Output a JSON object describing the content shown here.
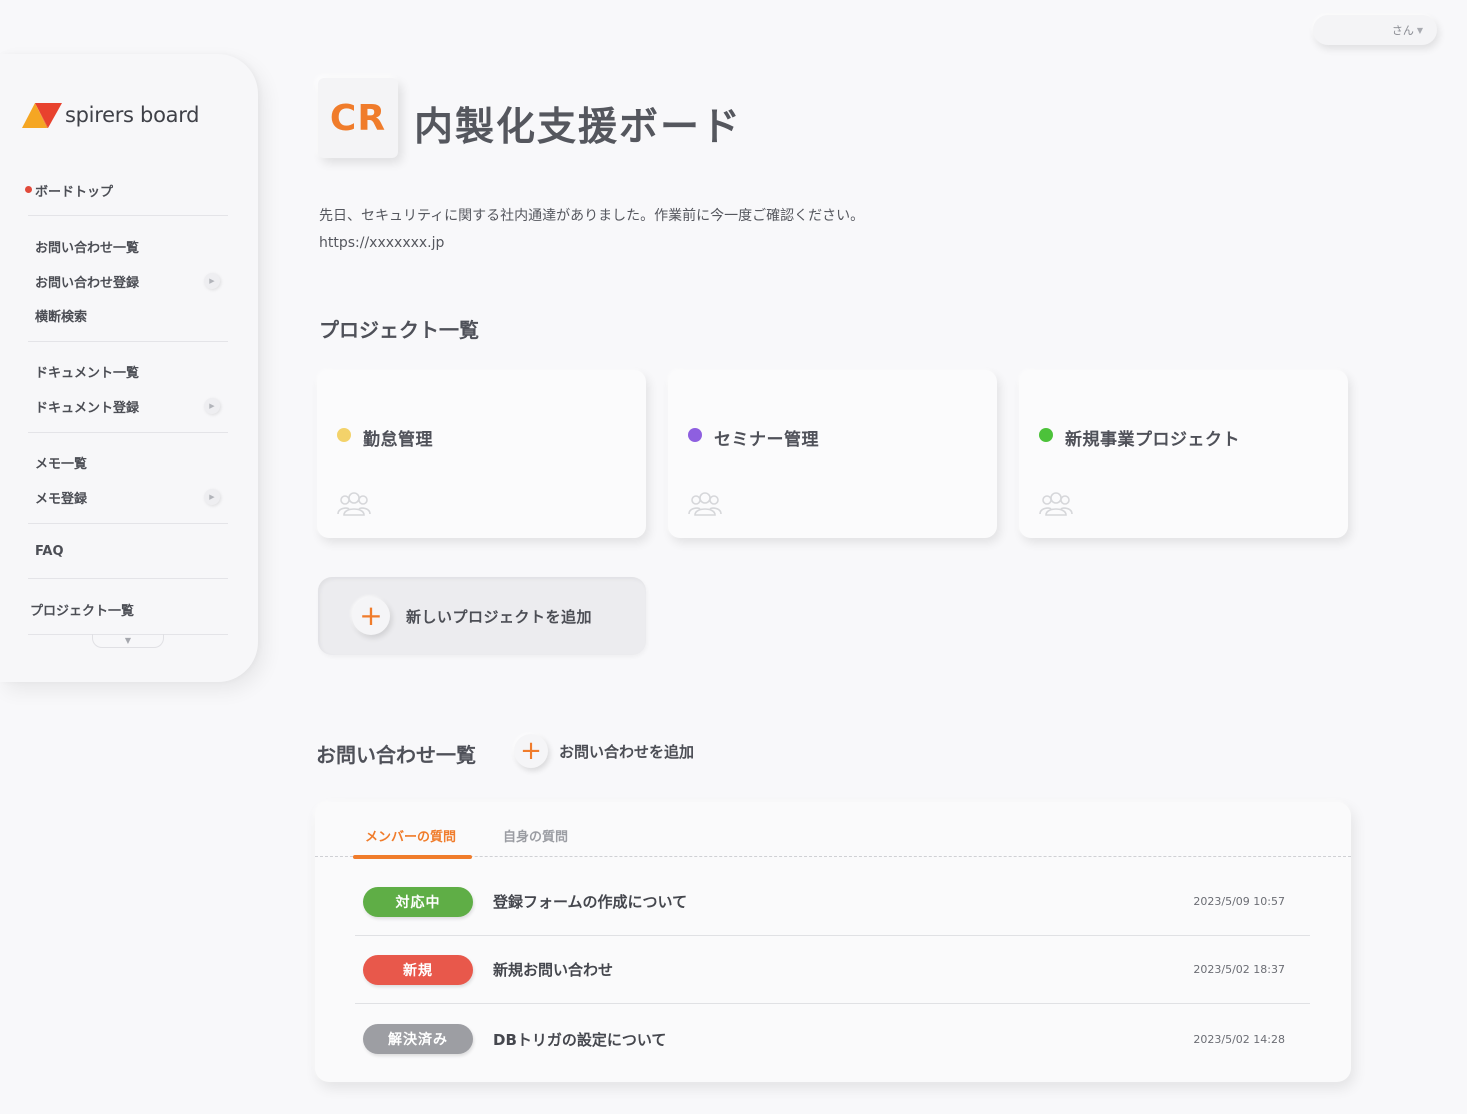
{
  "user": {
    "name_suffix": "さん"
  },
  "logo": {
    "text": "spirers board"
  },
  "sidebar": {
    "items": [
      {
        "label": "ボードトップ"
      },
      {
        "label": "お問い合わせ一覧"
      },
      {
        "label": "お問い合わせ登録"
      },
      {
        "label": "横断検索"
      },
      {
        "label": "ドキュメント一覧"
      },
      {
        "label": "ドキュメント登録"
      },
      {
        "label": "メモ一覧"
      },
      {
        "label": "メモ登録"
      },
      {
        "label": "FAQ"
      },
      {
        "label": "プロジェクト一覧"
      }
    ]
  },
  "board": {
    "badge": "CR",
    "title": "内製化支援ボード",
    "notice": "先日、セキュリティに関する社内通達がありました。作業前に今一度ご確認ください。",
    "url": "https://xxxxxxx.jp"
  },
  "projects": {
    "section_title": "プロジェクト一覧",
    "items": [
      {
        "name": "勤怠管理",
        "color": "#f3d26a"
      },
      {
        "name": "セミナー管理",
        "color": "#8e5fe0"
      },
      {
        "name": "新規事業プロジェクト",
        "color": "#4cc23a"
      }
    ],
    "add_label": "新しいプロジェクトを追加"
  },
  "inquiries": {
    "section_title": "お問い合わせ一覧",
    "add_label": "お問い合わせを追加",
    "tabs": [
      {
        "label": "メンバーの質問"
      },
      {
        "label": "自身の質問"
      }
    ],
    "rows": [
      {
        "status": "対応中",
        "status_color": "#5fae46",
        "title": "登録フォームの作成について",
        "date": "2023/5/09 10:57"
      },
      {
        "status": "新規",
        "status_color": "#e8584b",
        "title": "新規お問い合わせ",
        "date": "2023/5/02 18:37"
      },
      {
        "status": "解決済み",
        "status_color": "#9d9ea3",
        "title": "DBトリガの設定について",
        "date": "2023/5/02 14:28"
      }
    ]
  }
}
